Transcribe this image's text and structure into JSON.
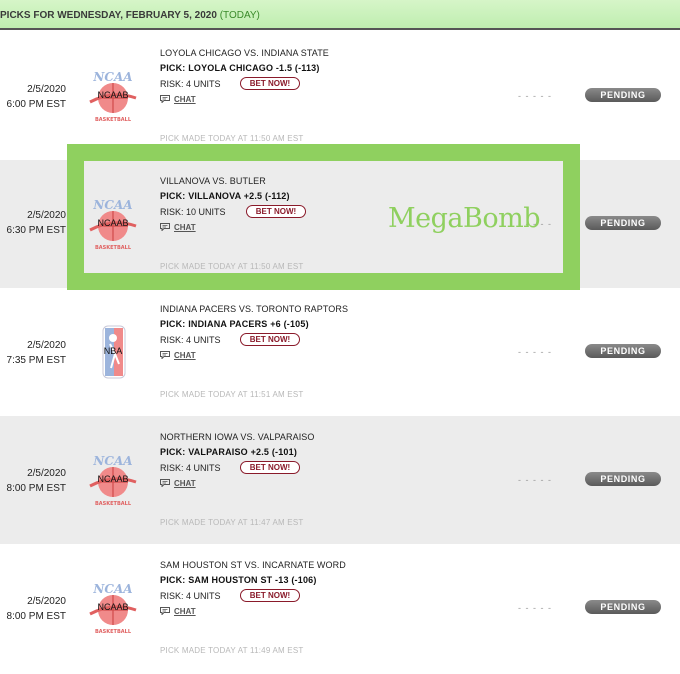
{
  "header": {
    "title": "PICKS FOR WEDNESDAY, FEBRUARY 5, 2020",
    "today": "(TODAY)"
  },
  "bet_label": "BET NOW!",
  "chat_label": "CHAT",
  "status_label": "PENDING",
  "result_placeholder": "- - - - -",
  "picks": [
    {
      "date": "2/5/2020",
      "time": "6:00 PM EST",
      "league": "NCAAB",
      "logo": "ncaa-basketball-logo",
      "matchup": "LOYOLA CHICAGO VS. INDIANA STATE",
      "pick": "PICK: LOYOLA CHICAGO -1.5 (-113)",
      "risk": "RISK: 4 UNITS",
      "made": "PICK MADE TODAY AT 11:50 AM EST"
    },
    {
      "date": "2/5/2020",
      "time": "6:30 PM EST",
      "league": "NCAAB",
      "logo": "ncaa-basketball-logo",
      "matchup": "VILLANOVA VS. BUTLER",
      "pick": "PICK: VILLANOVA +2.5 (-112)",
      "risk": "RISK: 10 UNITS",
      "made": "PICK MADE TODAY AT 11:50 AM EST"
    },
    {
      "date": "2/5/2020",
      "time": "7:35 PM EST",
      "league": "NBA",
      "logo": "nba-logo",
      "matchup": "INDIANA PACERS VS. TORONTO RAPTORS",
      "pick": "PICK: INDIANA PACERS +6 (-105)",
      "risk": "RISK: 4 UNITS",
      "made": "PICK MADE TODAY AT 11:51 AM EST"
    },
    {
      "date": "2/5/2020",
      "time": "8:00 PM EST",
      "league": "NCAAB",
      "logo": "ncaa-basketball-logo",
      "matchup": "NORTHERN IOWA VS. VALPARAISO",
      "pick": "PICK: VALPARAISO +2.5 (-101)",
      "risk": "RISK: 4 UNITS",
      "made": "PICK MADE TODAY AT 11:47 AM EST"
    },
    {
      "date": "2/5/2020",
      "time": "8:00 PM EST",
      "league": "NCAAB",
      "logo": "ncaa-basketball-logo",
      "matchup": "SAM HOUSTON ST VS. INCARNATE WORD",
      "pick": "PICK: SAM HOUSTON ST -13 (-106)",
      "risk": "RISK: 4 UNITS",
      "made": "PICK MADE TODAY AT 11:49 AM EST"
    }
  ],
  "watermark": "MegaBomb",
  "colors": {
    "header_bg": "#c8f0b8",
    "highlight": "#8fd05f",
    "bet_button": "#8a1a2a",
    "pending_badge": "#6a6a6a",
    "alt_row": "#ececec"
  }
}
